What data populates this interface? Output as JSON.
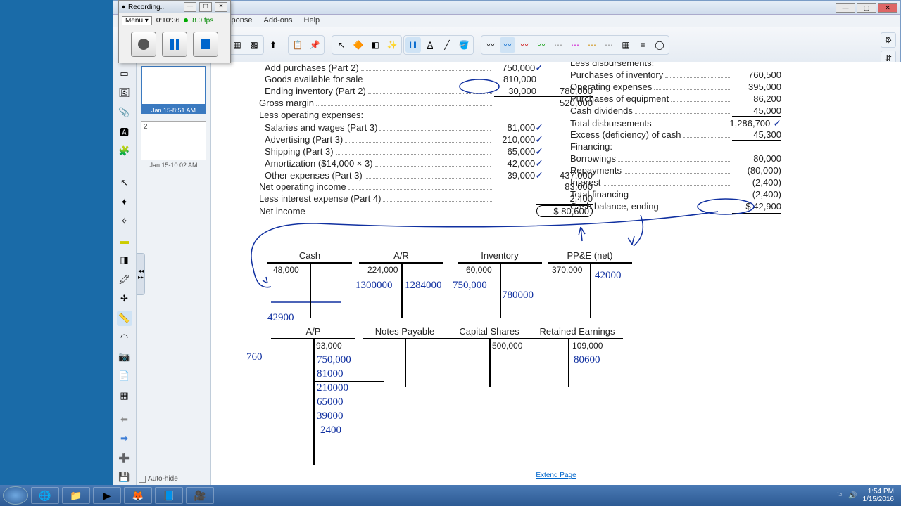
{
  "recording": {
    "title": "Recording...",
    "menu": "Menu",
    "time": "0:10:36",
    "fps": "8.0 fps"
  },
  "menus": [
    "Response",
    "Add-ons",
    "Help"
  ],
  "thumbs": {
    "t1": "Jan 15-8:51 AM",
    "t2n": "2",
    "t2": "Jan 15-10:02 AM",
    "autohide": "Auto-hide"
  },
  "income": {
    "l1": "Add purchases (Part 2)",
    "v1": "750,000",
    "l2": "Goods available for sale",
    "v2": "810,000",
    "l3": "Ending inventory (Part 2)",
    "v3": "30,000",
    "v3b": "780,000",
    "l4": "Gross margin",
    "v4": "520,000",
    "l5": "Less operating expenses:",
    "l6": "Salaries and wages (Part 3)",
    "v6": "81,000",
    "l7": "Advertising (Part 3)",
    "v7": "210,000",
    "l8": "Shipping (Part 3)",
    "v8": "65,000",
    "l9": "Amortization ($14,000 × 3)",
    "v9": "42,000",
    "l10": "Other expenses (Part 3)",
    "v10": "39,000",
    "v10b": "437,000",
    "l11": "Net operating income",
    "v11": "83,000",
    "l12": "Less interest expense (Part 4)",
    "v12": "2,400",
    "l13": "Net income",
    "v13": "$    80,600"
  },
  "cash": {
    "h": "Less disbursements:",
    "l1": "Purchases of inventory",
    "v1": "760,500",
    "l2": "Operating expenses",
    "v2": "395,000",
    "l3": "Purchases of equipment",
    "v3": "86,200",
    "l4": "Cash dividends",
    "v4": "45,000",
    "l5": "Total disbursements",
    "v5": "1,286,700",
    "l6": "Excess (deficiency) of cash",
    "v6": "45,300",
    "l7": "Financing:",
    "l8": "Borrowings",
    "v8": "80,000",
    "l9": "Repayments",
    "v9": "(80,000)",
    "l10": "Interest",
    "v10": "(2,400)",
    "l11": "Total financing",
    "v11": "(2,400)",
    "l12": "Cash balance, ending",
    "v12": "$    42,900"
  },
  "taccts": {
    "cash": {
      "n": "Cash",
      "b": "48,000"
    },
    "ar": {
      "n": "A/R",
      "b": "224,000"
    },
    "inv": {
      "n": "Inventory",
      "b": "60,000"
    },
    "ppe": {
      "n": "PP&E (net)",
      "b": "370,000"
    },
    "ap": {
      "n": "A/P",
      "b": "93,000"
    },
    "np": {
      "n": "Notes Payable"
    },
    "cs": {
      "n": "Capital Shares",
      "b": "500,000"
    },
    "re": {
      "n": "Retained Earnings",
      "b": "109,000"
    }
  },
  "hw": {
    "cash_end": "42900",
    "ar_d": "1300000",
    "ar_c": "1284000",
    "inv_d": "750,000",
    "inv_c": "780000",
    "ppe": "42000",
    "ap_partial": "760",
    "ap1": "750,000",
    "ap2": "81000",
    "ap3": "210000",
    "ap4": "65000",
    "ap5": "39000",
    "ap6": "2400",
    "re": "80600"
  },
  "extend": "Extend Page",
  "clock": {
    "t": "1:54 PM",
    "d": "1/15/2016"
  }
}
